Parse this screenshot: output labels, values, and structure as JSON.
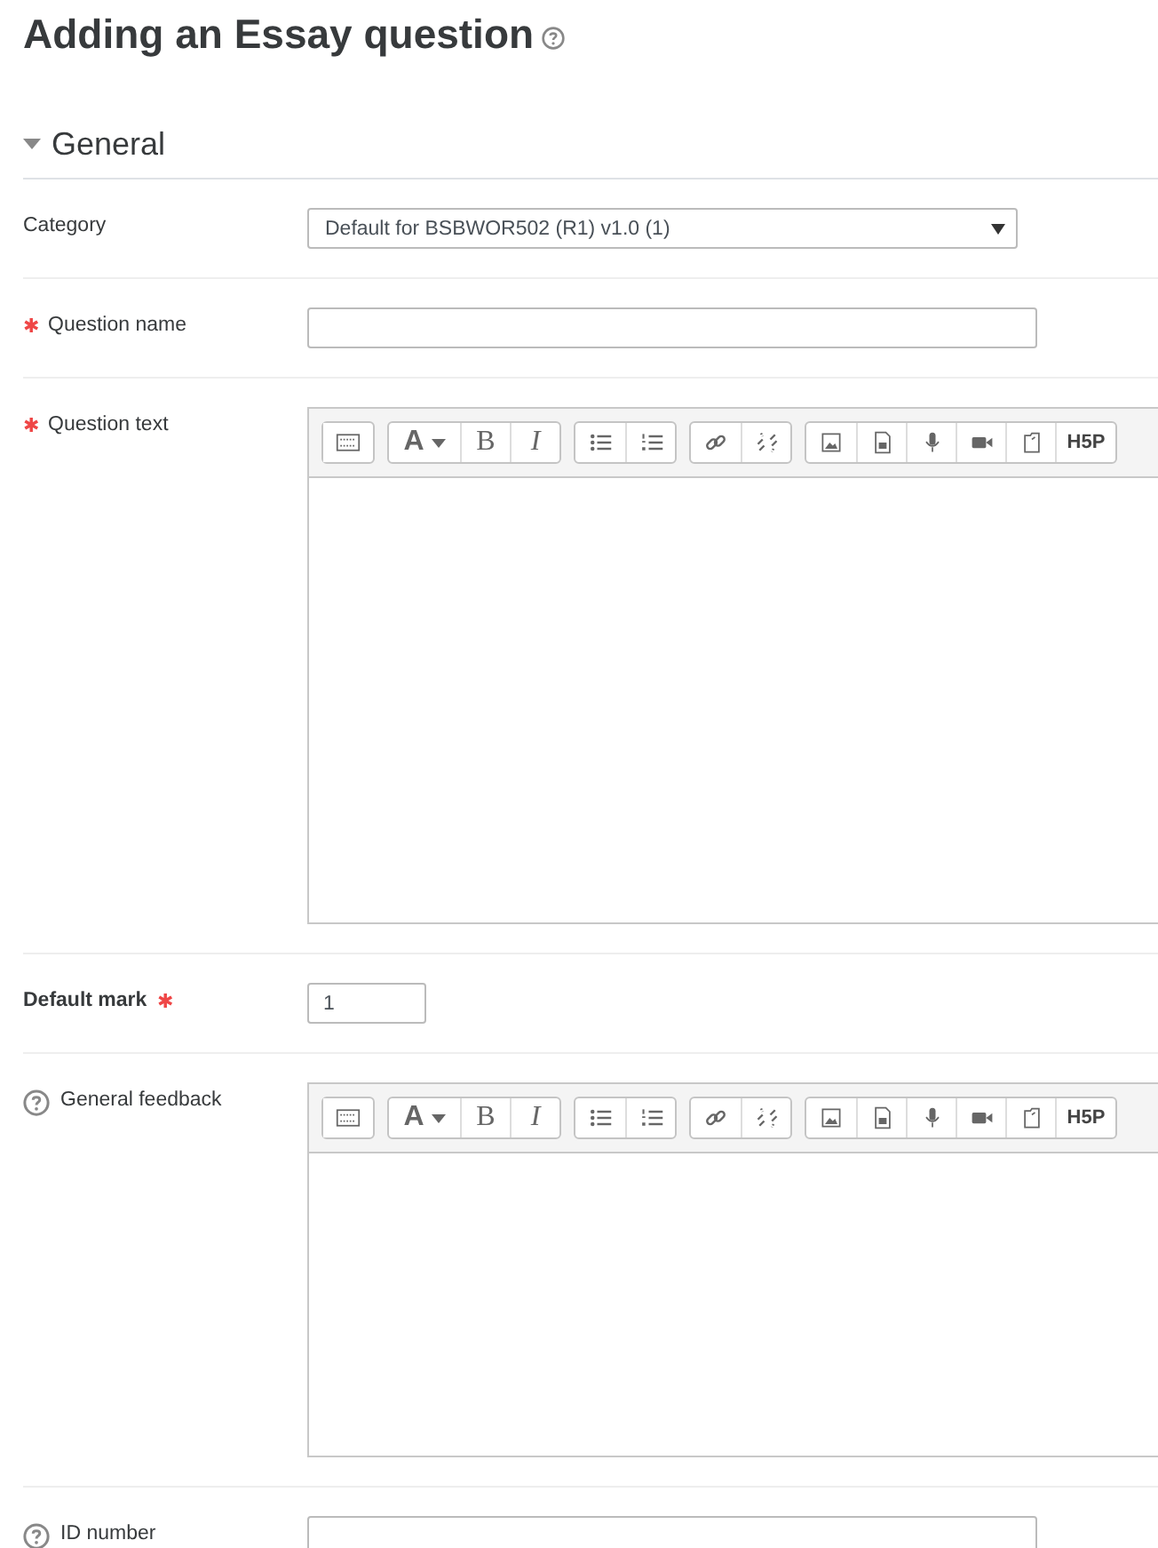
{
  "page_title": "Adding an Essay question",
  "section": {
    "title": "General",
    "expanded": true
  },
  "fields": [
    {
      "kind": "select",
      "label": "Category",
      "help": false,
      "emphasis": false,
      "value": "Default for BSBWOR502 (R1) v1.0 (1)"
    },
    {
      "kind": "text",
      "label": "Question name",
      "required_mark": "✱",
      "help": false,
      "emphasis": false
    },
    {
      "kind": "editor",
      "label": "Question text",
      "required_mark": "✱",
      "help": false,
      "emphasis": false,
      "toolbar": [
        {
          "buttons": [
            {
              "kind": "collapse"
            }
          ]
        },
        {
          "buttons": [
            {
              "kind": "font",
              "text": "A"
            },
            {
              "kind": "bold",
              "text": "B"
            },
            {
              "kind": "italic",
              "text": "I"
            }
          ]
        },
        {
          "buttons": [
            {
              "kind": "bullets"
            },
            {
              "kind": "numbers"
            }
          ]
        },
        {
          "buttons": [
            {
              "kind": "link"
            },
            {
              "kind": "unlink"
            }
          ]
        },
        {
          "buttons": [
            {
              "kind": "image"
            },
            {
              "kind": "media"
            },
            {
              "kind": "audio"
            },
            {
              "kind": "video"
            },
            {
              "kind": "files"
            },
            {
              "kind": "h5p",
              "text": "H5P"
            }
          ]
        }
      ]
    },
    {
      "kind": "text",
      "label": "Default mark",
      "required_mark": "✱",
      "help": false,
      "emphasis": true,
      "value": "1"
    },
    {
      "kind": "editor",
      "label": "General feedback",
      "help": true,
      "emphasis": false,
      "toolbar": [
        {
          "buttons": [
            {
              "kind": "collapse"
            }
          ]
        },
        {
          "buttons": [
            {
              "kind": "font",
              "text": "A"
            },
            {
              "kind": "bold",
              "text": "B"
            },
            {
              "kind": "italic",
              "text": "I"
            }
          ]
        },
        {
          "buttons": [
            {
              "kind": "bullets"
            },
            {
              "kind": "numbers"
            }
          ]
        },
        {
          "buttons": [
            {
              "kind": "link"
            },
            {
              "kind": "unlink"
            }
          ]
        },
        {
          "buttons": [
            {
              "kind": "image"
            },
            {
              "kind": "media"
            },
            {
              "kind": "audio"
            },
            {
              "kind": "video"
            },
            {
              "kind": "files"
            },
            {
              "kind": "h5p",
              "text": "H5P"
            }
          ]
        }
      ]
    },
    {
      "kind": "text",
      "label": "ID number",
      "help": true,
      "emphasis": false
    }
  ]
}
